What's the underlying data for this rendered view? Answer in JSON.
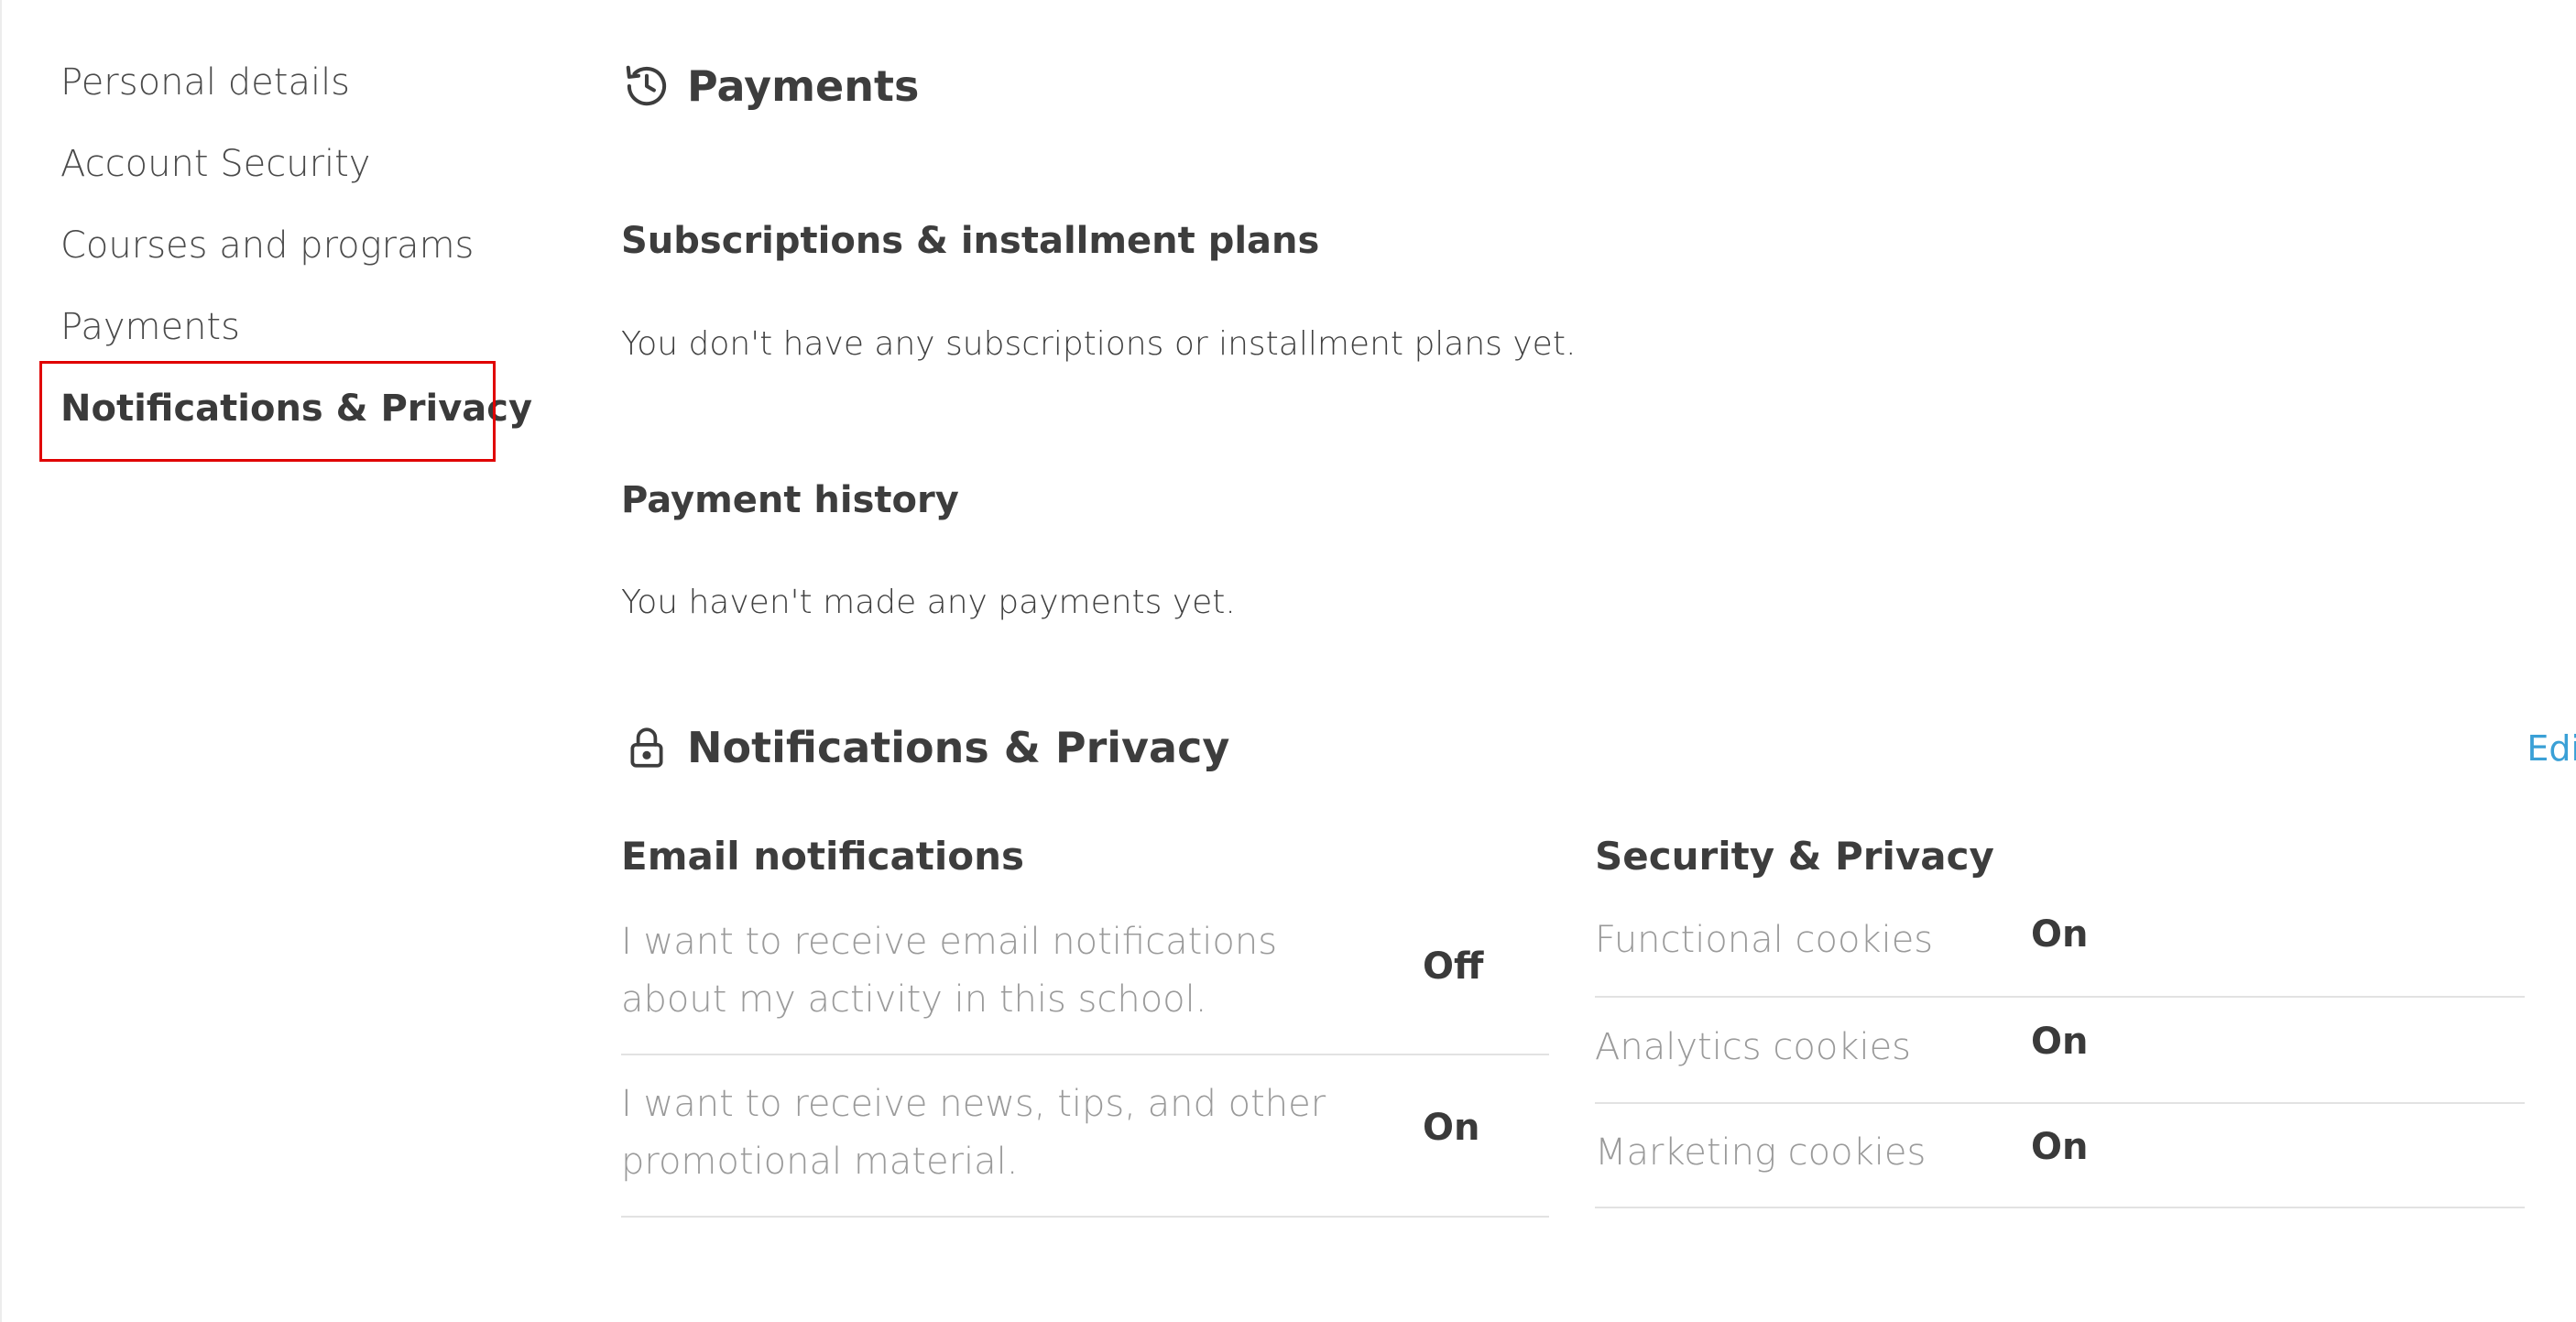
{
  "sidebar": {
    "items": [
      {
        "label": "Personal details"
      },
      {
        "label": "Account Security"
      },
      {
        "label": "Courses and programs"
      },
      {
        "label": "Payments"
      },
      {
        "label": "Notifications & Privacy"
      }
    ],
    "active_index": 4,
    "highlight_color": "#e00000"
  },
  "payments": {
    "icon": "history-icon",
    "title": "Payments",
    "subscriptions_title": "Subscriptions & installment plans",
    "subscriptions_empty": "You don't have any subscriptions or installment plans yet.",
    "history_title": "Payment history",
    "history_empty": "You haven't made any payments yet."
  },
  "notifications": {
    "icon": "lock-icon",
    "title": "Notifications & Privacy",
    "edit_label": "Edit",
    "edit_color": "#3aa0d6",
    "email": {
      "title": "Email notifications",
      "rows": [
        {
          "label": "I want to receive email notifications about my activity in this school.",
          "value": "Off"
        },
        {
          "label": "I want to receive news, tips, and other promotional material.",
          "value": "On"
        }
      ]
    },
    "privacy": {
      "title": "Security & Privacy",
      "rows": [
        {
          "label": "Functional cookies",
          "value": "On"
        },
        {
          "label": "Analytics cookies",
          "value": "On"
        },
        {
          "label": "Marketing cookies",
          "value": "On"
        }
      ]
    }
  }
}
